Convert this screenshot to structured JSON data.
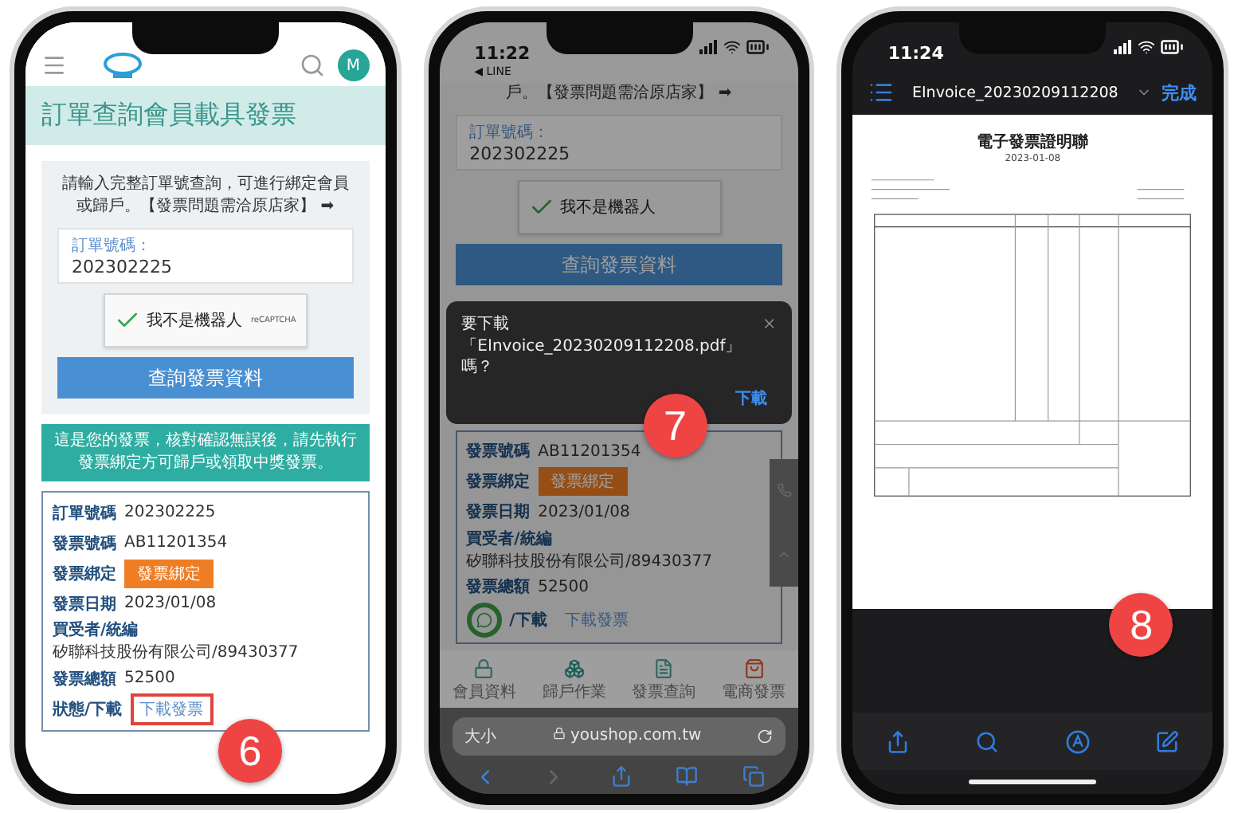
{
  "invoice_query_screen": {
    "avatar": "M",
    "page_title": "訂單查詢會員載具發票",
    "instructions": "請輸入完整訂單號查詢，可進行綁定會員或歸戶。【發票問題需洽原店家】 ➡",
    "order_field": {
      "label": "訂單號碼：",
      "value": "202302225"
    },
    "captcha": {
      "label": "我不是機器人",
      "checked": true,
      "brand": "reCAPTCHA"
    },
    "query_button": "查詢發票資料",
    "notice": "這是您的發票，核對確認無誤後，請先執行發票綁定方可歸戶或領取中獎發票。",
    "rows": [
      {
        "label": "訂單號碼",
        "value": "202302225",
        "kind": "text"
      },
      {
        "label": "發票號碼",
        "value": "AB11201354",
        "kind": "text"
      },
      {
        "label": "發票綁定",
        "value": "發票綁定",
        "kind": "button"
      },
      {
        "label": "發票日期",
        "value": "2023/01/08",
        "kind": "text"
      },
      {
        "label": "買受者/統編",
        "value": "矽聯科技股份有限公司/89430377",
        "kind": "text"
      },
      {
        "label": "發票總額",
        "value": "52500",
        "kind": "text"
      },
      {
        "label": "狀態/下載",
        "value": "下載發票",
        "kind": "link",
        "highlighted": true
      }
    ],
    "step": "6"
  },
  "download_prompt_screen": {
    "time": "11:22",
    "back_link": "◀ LINE",
    "instructions": "戶。【發票問題需洽原店家】 ➡",
    "order_field": {
      "label": "訂單號碼：",
      "value": "202302225"
    },
    "captcha": {
      "label": "我不是機器人",
      "checked": true
    },
    "query_button": "查詢發票資料",
    "dialog": {
      "message": "要下載「EInvoice_20230209112208.pdf」嗎？",
      "confirm": "下載"
    },
    "rows": [
      {
        "label": "發票號碼",
        "value": "AB11201354",
        "kind": "text"
      },
      {
        "label": "發票綁定",
        "value": "發票綁定",
        "kind": "button"
      },
      {
        "label": "發票日期",
        "value": "2023/01/08",
        "kind": "text"
      },
      {
        "label": "買受者/統編",
        "value": "矽聯科技股份有限公司/89430377",
        "kind": "text"
      },
      {
        "label": "發票總額",
        "value": "52500",
        "kind": "text"
      },
      {
        "label": "/下載",
        "value": "下載發票",
        "kind": "link",
        "highlighted": false
      }
    ],
    "bottom_nav": [
      {
        "label": "會員資料",
        "kind": "lock"
      },
      {
        "label": "歸戶作業",
        "kind": "boxes"
      },
      {
        "label": "發票查詢",
        "kind": "document"
      },
      {
        "label": "電商發票",
        "kind": "bag"
      }
    ],
    "address_bar": {
      "text_size": "大小",
      "url": "youshop.com.tw"
    },
    "step": "7"
  },
  "pdf_viewer_screen": {
    "time": "11:24",
    "title": "EInvoice_20230209112208",
    "done": "完成",
    "document": {
      "title": "電子發票證明聯",
      "date": "2023-01-08"
    },
    "step": "8"
  }
}
